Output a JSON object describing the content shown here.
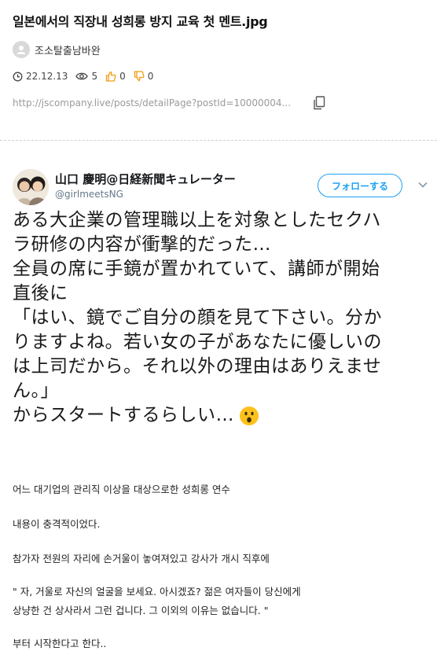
{
  "post": {
    "title": "일본에서의 직장내 성희롱 방지 교육 첫 멘트.jpg",
    "author": "조소탈출남바완",
    "date": "22.12.13",
    "views": "5",
    "likes": "0",
    "dislikes": "0",
    "url": "http://jscompany.live/posts/detailPage?postId=10000004..."
  },
  "tweet": {
    "name": "山口 慶明@日経新聞キュレーター",
    "handle": "@girlmeetsNG",
    "follow_label": "フォローする",
    "lines": [
      "ある大企業の管理職以上を対象としたセクハ",
      "ラ研修の内容が衝撃的だった…",
      "全員の席に手鏡が置かれていて、講師が開始",
      "直後に",
      "「はい、鏡でご自分の顔を見て下さい。分か",
      "りますよね。若い女の子があなたに優しいの",
      "は上司だから。それ以外の理由はありえませ",
      "ん。」",
      "からスタートするらしい…"
    ]
  },
  "body": {
    "p1": "어느 대기업의 관리직 이상을 대상으로한 성희롱 연수",
    "p2": "내용이 충격적이었다.",
    "p3": "참가자 전원의 자리에 손거울이 놓여져있고 강사가 개시 직후에",
    "p4a": " \" 자, 거울로 자신의 얼굴을 보세요. 아시겠죠? 젊은 여자들이 당신에게",
    "p4b": "상냥한 건 상사라서 그런 겁니다. 그 이외의 이유는 없습니다.  \"",
    "p5": "부터 시작한다고 한다.."
  },
  "colors": {
    "accent_blue": "#1da1f2",
    "like_orange": "#f39c12",
    "muted_gray": "#9a9a9a"
  }
}
